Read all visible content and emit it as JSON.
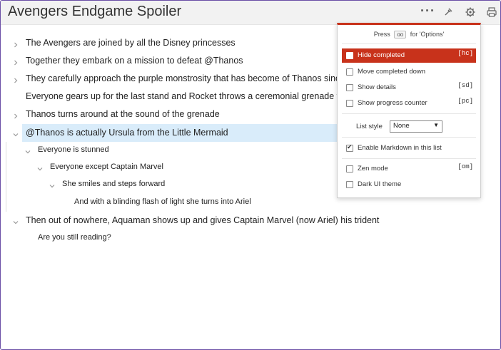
{
  "header": {
    "title": "Avengers Endgame Spoiler",
    "icons": [
      "more-dots-icon",
      "pin-icon",
      "gear-icon",
      "print-icon"
    ],
    "more_glyph": "···"
  },
  "outline": [
    {
      "text": "The Avengers are joined by all the Disney princesses",
      "chevron": "right"
    },
    {
      "text": "Together they embark on a mission to defeat @Thanos",
      "chevron": "right"
    },
    {
      "text": "They carefully approach the purple monstrosity that has become of Thanos since they",
      "chevron": "right"
    },
    {
      "text": "Everyone gears up for the last stand and Rocket throws a ceremonial grenade to start",
      "chevron": ""
    },
    {
      "text": "Thanos turns around at the sound of the grenade",
      "chevron": "right"
    },
    {
      "text": "@Thanos is actually Ursula from the Little Mermaid",
      "chevron": "down",
      "selected": true
    },
    {
      "text": "Everyone is stunned",
      "chevron": "down"
    },
    {
      "text": "Everyone except Captain Marvel",
      "chevron": "down"
    },
    {
      "text": "She smiles and steps forward",
      "chevron": "down"
    },
    {
      "text": "And with a blinding flash of light she turns into Ariel",
      "chevron": ""
    },
    {
      "text": "Then out of nowhere, Aquaman shows up and gives Captain Marvel (now Ariel) his trident",
      "chevron": "down"
    },
    {
      "text": "Are you still reading?",
      "chevron": ""
    }
  ],
  "options_panel": {
    "press_prefix": "Press",
    "press_key": "oo",
    "press_suffix": "for 'Options'",
    "items": [
      {
        "label": "Hide completed",
        "shortcut": "[hc]",
        "checked": false,
        "active": true
      },
      {
        "label": "Move completed down",
        "shortcut": "",
        "checked": false
      },
      {
        "label": "Show details",
        "shortcut": "[sd]",
        "checked": false
      },
      {
        "label": "Show progress counter",
        "shortcut": "[pc]",
        "checked": false
      }
    ],
    "list_style_label": "List style",
    "list_style_value": "None",
    "markdown": {
      "label": "Enable Markdown in this list",
      "checked": true
    },
    "items2": [
      {
        "label": "Zen mode",
        "shortcut": "[om]",
        "checked": false
      },
      {
        "label": "Dark UI theme",
        "shortcut": "",
        "checked": false
      }
    ]
  },
  "colors": {
    "accent": "#c8321b",
    "selected_row": "#d9ecfa",
    "header_bg": "#f2f2f2"
  }
}
